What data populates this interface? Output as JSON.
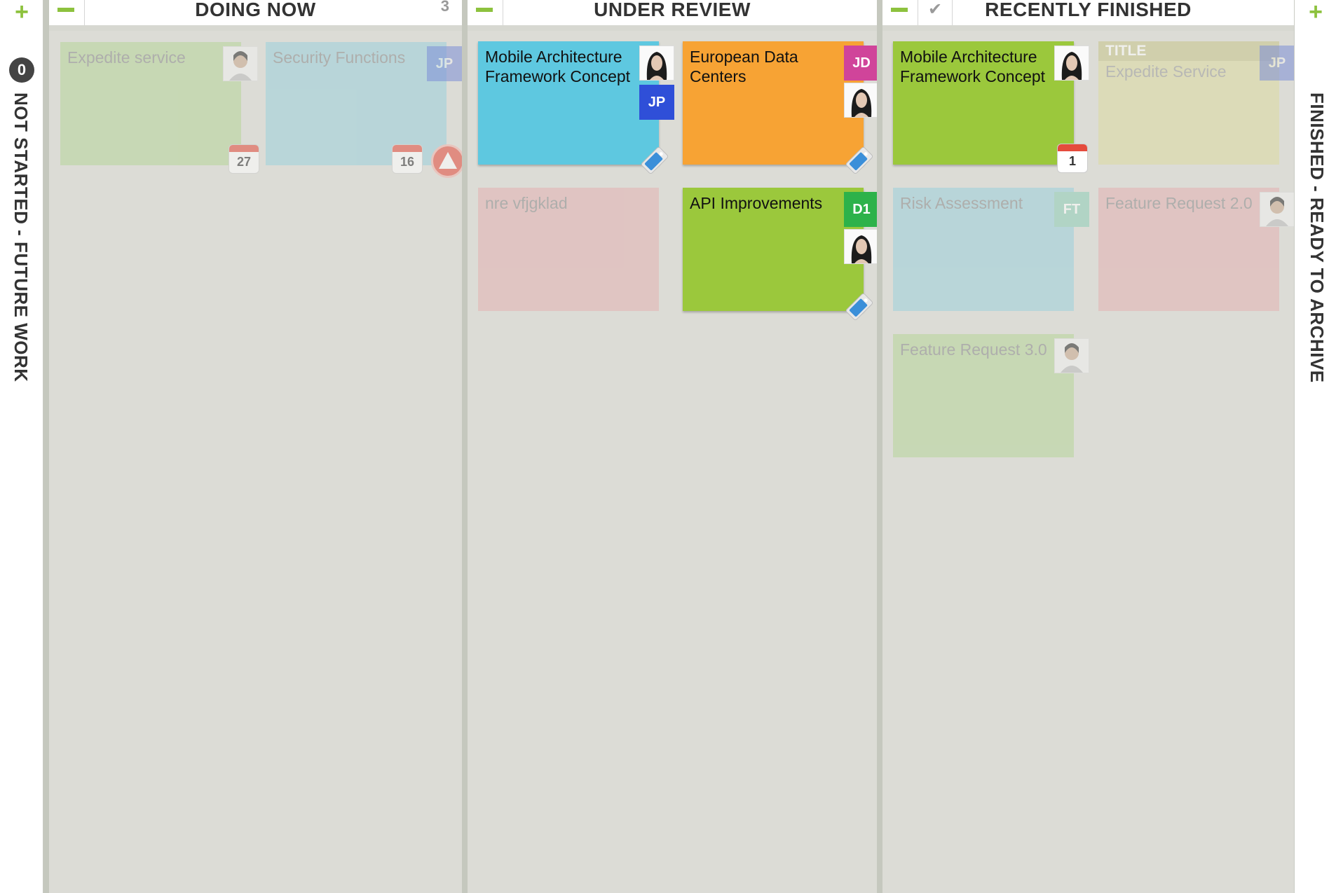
{
  "colors": {
    "accent": "#8dc23e",
    "blue_card": "#5ec8e0",
    "orange_card": "#f7a334",
    "green_card": "#9bc83c",
    "faded_green": "#b7d59a",
    "faded_blue": "#9cd1dd",
    "faded_red": "#e4b2b2",
    "faded_khaki": "#dcdba0",
    "jp_blue": "#2f4fd8",
    "jd_magenta": "#d0449a",
    "d1_green": "#2db24a",
    "ft_teal": "#8fcfb8"
  },
  "left_column": {
    "add_icon": "plus-icon",
    "count": "0",
    "label": "NOT STARTED - FUTURE WORK"
  },
  "right_column": {
    "add_icon": "plus-icon",
    "label": "FINISHED - READY TO ARCHIVE"
  },
  "lanes": {
    "doing": {
      "title": "DOING NOW",
      "count": "3",
      "cards": [
        {
          "title": "Expedite service",
          "date": "27"
        },
        {
          "title": "Security Functions",
          "initials": "JP",
          "date": "16"
        }
      ]
    },
    "review": {
      "title": "UNDER REVIEW",
      "cards": [
        {
          "title": "Mobile Architecture Framework Concept",
          "initials": "JP"
        },
        {
          "title": "European Data Centers",
          "initials": "JD"
        },
        {
          "title": "nre vfjgklad"
        },
        {
          "title": "API Improvements",
          "initials": "D1"
        }
      ]
    },
    "finished": {
      "title": "RECENTLY FINISHED",
      "cards": [
        {
          "title": "Mobile Architecture Framework Concept",
          "date": "1"
        },
        {
          "label": "TITLE",
          "title": "Expedite Service",
          "initials": "JP"
        },
        {
          "title": "Risk Assessment",
          "initials": "FT"
        },
        {
          "title": "Feature Request 2.0"
        },
        {
          "title": "Feature Request 3.0"
        }
      ]
    }
  }
}
